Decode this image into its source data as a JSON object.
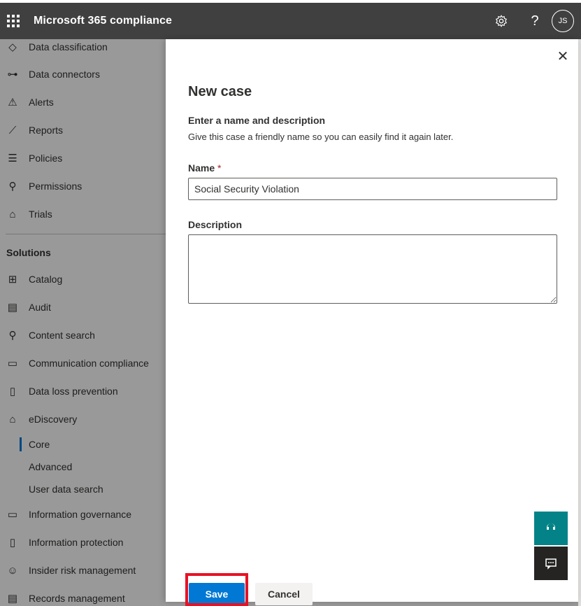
{
  "header": {
    "app_title": "Microsoft 365 compliance",
    "settings_icon": "gear-icon",
    "help_icon": "question-icon",
    "avatar_initials": "JS"
  },
  "leftnav": {
    "items_top": [
      {
        "label": "Data classification",
        "icon": "tag-icon"
      },
      {
        "label": "Data connectors",
        "icon": "connector-icon"
      },
      {
        "label": "Alerts",
        "icon": "warning-icon"
      },
      {
        "label": "Reports",
        "icon": "chart-icon"
      },
      {
        "label": "Policies",
        "icon": "sliders-icon"
      },
      {
        "label": "Permissions",
        "icon": "key-icon"
      },
      {
        "label": "Trials",
        "icon": "gift-icon"
      }
    ],
    "solutions_heading": "Solutions",
    "items_solutions": [
      {
        "label": "Catalog",
        "icon": "grid-icon"
      },
      {
        "label": "Audit",
        "icon": "document-icon"
      },
      {
        "label": "Content search",
        "icon": "search-icon"
      },
      {
        "label": "Communication compliance",
        "icon": "chat-icon"
      },
      {
        "label": "Data loss prevention",
        "icon": "file-shield-icon"
      },
      {
        "label": "eDiscovery",
        "icon": "bank-icon"
      }
    ],
    "ediscovery_sub": [
      "Core",
      "Advanced",
      "User data search"
    ],
    "items_bottom": [
      {
        "label": "Information governance",
        "icon": "archive-icon"
      },
      {
        "label": "Information protection",
        "icon": "lock-file-icon"
      },
      {
        "label": "Insider risk management",
        "icon": "person-icon"
      },
      {
        "label": "Records management",
        "icon": "records-icon"
      }
    ]
  },
  "panel": {
    "title": "New case",
    "section_title": "Enter a name and description",
    "section_desc": "Give this case a friendly name so you can easily find it again later.",
    "name_label": "Name",
    "required_mark": "*",
    "name_value": "Social Security Violation",
    "description_label": "Description",
    "description_value": "",
    "save_label": "Save",
    "cancel_label": "Cancel"
  }
}
